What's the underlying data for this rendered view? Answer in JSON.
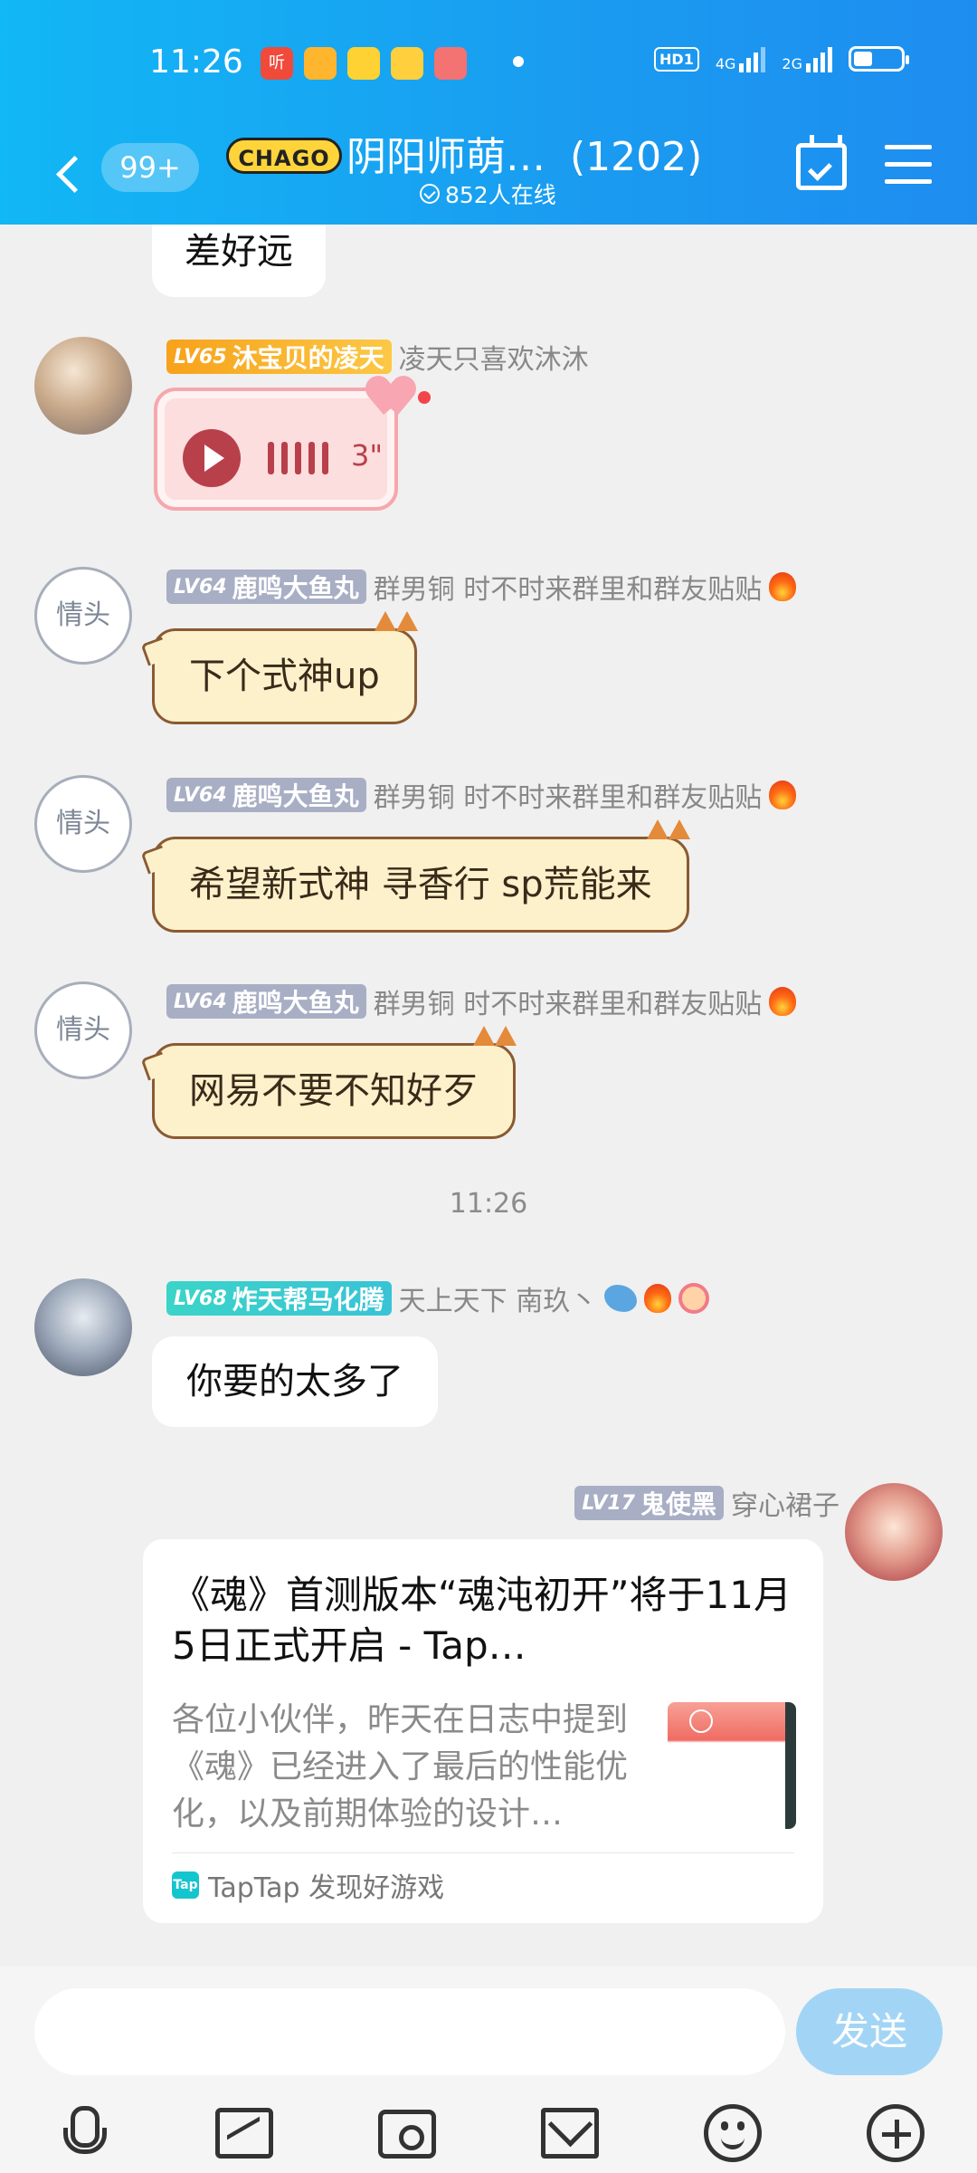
{
  "status_bar": {
    "time": "11:26",
    "notification_icons": [
      "ting-icon",
      "app-icon",
      "yuanmeng-icon",
      "wallet-icon",
      "game-icon"
    ],
    "ting_label": "听",
    "network": "HD1",
    "net1": "4G",
    "net2": "2G"
  },
  "header": {
    "unread_count": "99+",
    "group_logo": "CHAGO",
    "group_title": "阴阳师萌…",
    "member_count": "(1202)",
    "online_text": "852人在线"
  },
  "messages": [
    {
      "type": "text",
      "text": "差好远"
    },
    {
      "type": "voice",
      "level": "LV65",
      "nickname": "沐宝贝的凌天",
      "title": "凌天只喜欢沐沐",
      "duration": "3\""
    },
    {
      "type": "text",
      "level": "LV64",
      "nickname": "鹿鸣大鱼丸",
      "title": "群男铜 时不时来群里和群友贴贴",
      "avatar_text": "情头",
      "text": "下个式神up"
    },
    {
      "type": "text",
      "level": "LV64",
      "nickname": "鹿鸣大鱼丸",
      "title": "群男铜 时不时来群里和群友贴贴",
      "avatar_text": "情头",
      "text": "希望新式神 寻香行 sp荒能来"
    },
    {
      "type": "text",
      "level": "LV64",
      "nickname": "鹿鸣大鱼丸",
      "title": "群男铜 时不时来群里和群友贴贴",
      "avatar_text": "情头",
      "text": "网易不要不知好歹"
    },
    {
      "type": "text",
      "level": "LV68",
      "nickname": "炸天帮马化腾",
      "title": "天上天下 南玖丶",
      "text": "你要的太多了"
    },
    {
      "type": "link",
      "level": "LV17",
      "nickname": "鬼使黑",
      "title": "穿心裙子",
      "card_title": "《魂》首测版本“魂沌初开”将于11月5日正式开启 - Tap…",
      "card_desc": "各位小伙伴，昨天在日志中提到《魂》已经进入了最后的性能优化，以及前期体验的设计…",
      "card_source": "TapTap 发现好游戏",
      "source_icon_label": "Tap"
    }
  ],
  "timestamp": "11:26",
  "input": {
    "placeholder": "",
    "send_label": "发送"
  },
  "toolbar": [
    "mic-icon",
    "photo-icon",
    "camera-icon",
    "envelope-icon",
    "emoji-icon",
    "plus-icon"
  ],
  "colors": {
    "header_start": "#12b7f5",
    "header_end": "#1e8df0",
    "send_button": "#a2d5f5",
    "cat_bubble": "#fdf1cb"
  }
}
